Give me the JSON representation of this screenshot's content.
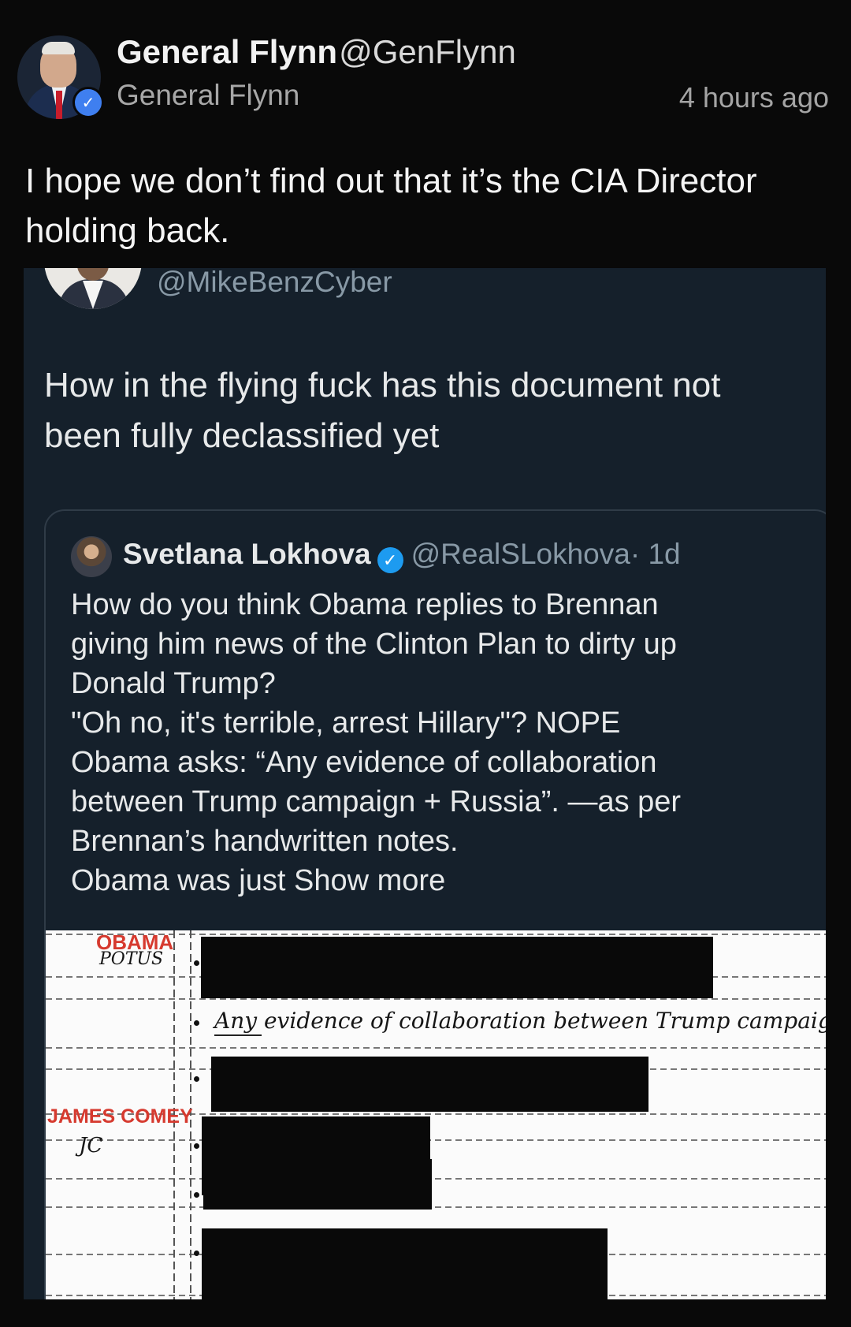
{
  "post": {
    "name": "General Flynn",
    "handle": "@GenFlynn",
    "display_name": "General Flynn",
    "timestamp": "4 hours ago",
    "text": "I hope we don’t find out that it’s the CIA Director holding back."
  },
  "embed": {
    "handle": "@MikeBenzCyber",
    "text": "How in the flying fuck has this document not been fully declassified yet",
    "quote": {
      "name": "Svetlana Lokhova",
      "handle": "@RealSLokhova",
      "age": "· 1d",
      "lines": [
        "How do you think Obama replies to Brennan",
        "giving him news of the Clinton Plan to dirty up",
        "Donald Trump?",
        "\"Oh no, it's terrible, arrest Hillary\"? NOPE",
        "Obama asks: “Any evidence of collaboration",
        "between Trump campaign + Russia”. —as per",
        "Brennan’s handwritten notes.",
        "Obama was just"
      ],
      "show_more": "Show more"
    }
  },
  "document": {
    "label_obama": "OBAMA",
    "hand_potus": "POTUS",
    "handwritten_note": "Any evidence of collaboration between Trump campaign + Russia",
    "label_comey": "JAMES COMEY",
    "hand_jc": "JC"
  }
}
